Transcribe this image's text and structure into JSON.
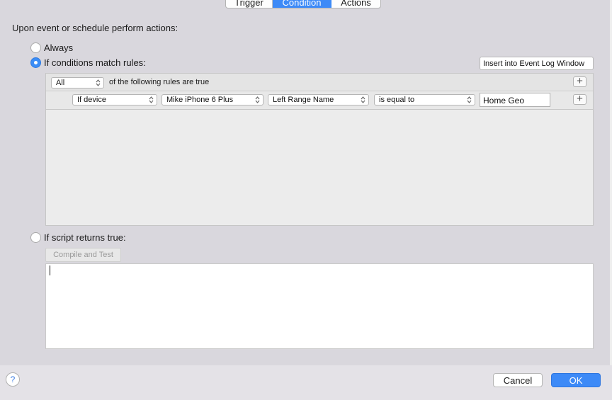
{
  "tabs": [
    {
      "label": "Trigger",
      "active": false
    },
    {
      "label": "Condition",
      "active": true
    },
    {
      "label": "Actions",
      "active": false
    }
  ],
  "heading": "Upon event or schedule perform actions:",
  "options": {
    "always": "Always",
    "conditions": "If conditions match rules:",
    "script": "If script returns true:",
    "selected": "conditions"
  },
  "insert_button": "Insert into Event Log Window",
  "rules": {
    "match_select": "All",
    "match_text": "of the following rules are true",
    "rule": {
      "subject": "If device",
      "device": "Mike iPhone 6 Plus",
      "attribute": "Left Range Name",
      "operator": "is equal to",
      "value": "Home Geo"
    }
  },
  "compile_button": "Compile and Test",
  "script_text": "",
  "help_label": "?",
  "cancel_label": "Cancel",
  "ok_label": "OK",
  "colors": {
    "accent": "#3d8af7",
    "background": "#d9d7dd"
  }
}
